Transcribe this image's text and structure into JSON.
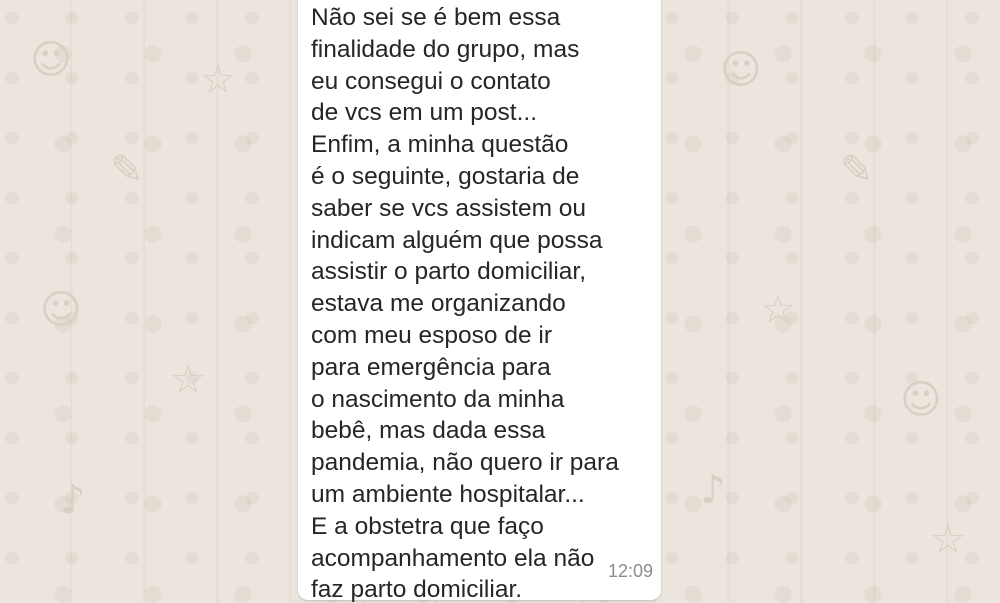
{
  "chat": {
    "background_color": "#ece5dd",
    "bubble_color": "#ffffff",
    "message": {
      "text": "Não sei se é bem essa\nfinalidade do grupo, mas\neu consegui o contato\nde vcs em um post...\nEnfim, a minha questão\né o seguinte, gostaria de\nsaber se vcs assistem ou\nindicam alguém que possa\nassistir o parto domiciliar,\nestava me organizando\ncom meu esposo de ir\npara emergência para\no nascimento da minha\nbebê, mas dada essa\npandemia, não quero ir para\num ambiente hospitalar...\nE a obstetra que faço\nacompanhamento ela não\nfaz parto domiciliar.",
      "time": "12:09"
    }
  }
}
